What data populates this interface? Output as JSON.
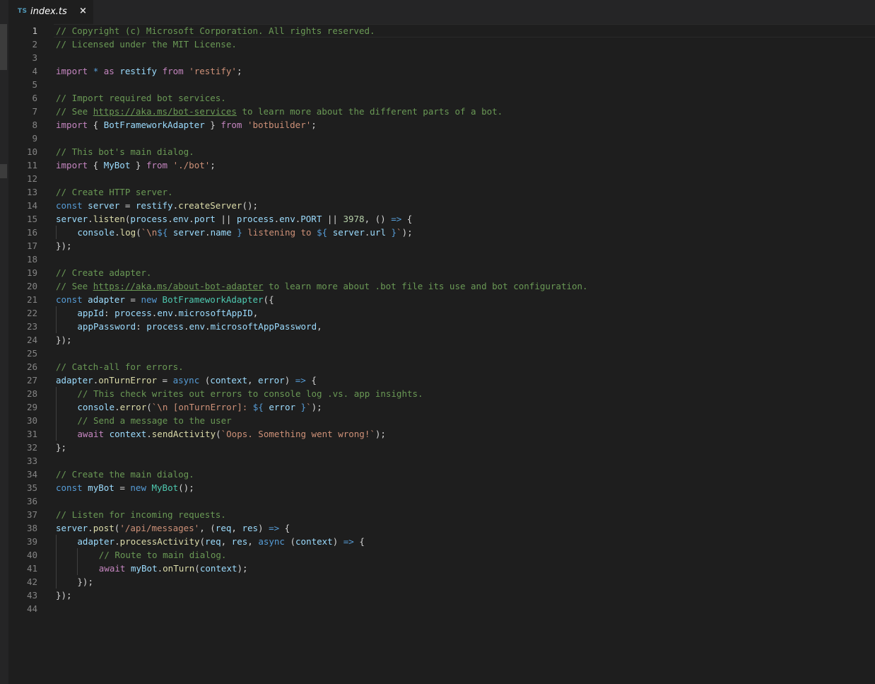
{
  "tab": {
    "language_badge": "TS",
    "filename": "index.ts",
    "close_glyph": "×"
  },
  "editor": {
    "active_line": 1,
    "lines": [
      {
        "n": 1,
        "indent": 0,
        "tokens": [
          {
            "t": "// Copyright (c) Microsoft Corporation. All rights reserved.",
            "c": "comment"
          }
        ]
      },
      {
        "n": 2,
        "indent": 0,
        "tokens": [
          {
            "t": "// Licensed under the MIT License.",
            "c": "comment"
          }
        ]
      },
      {
        "n": 3,
        "indent": 0,
        "tokens": []
      },
      {
        "n": 4,
        "indent": 0,
        "tokens": [
          {
            "t": "import",
            "c": "keyword"
          },
          {
            "t": " ",
            "c": "plain"
          },
          {
            "t": "*",
            "c": "storage"
          },
          {
            "t": " ",
            "c": "plain"
          },
          {
            "t": "as",
            "c": "keyword"
          },
          {
            "t": " ",
            "c": "plain"
          },
          {
            "t": "restify",
            "c": "var"
          },
          {
            "t": " ",
            "c": "plain"
          },
          {
            "t": "from",
            "c": "keyword"
          },
          {
            "t": " ",
            "c": "plain"
          },
          {
            "t": "'restify'",
            "c": "string"
          },
          {
            "t": ";",
            "c": "plain"
          }
        ]
      },
      {
        "n": 5,
        "indent": 0,
        "tokens": []
      },
      {
        "n": 6,
        "indent": 0,
        "tokens": [
          {
            "t": "// Import required bot services.",
            "c": "comment"
          }
        ]
      },
      {
        "n": 7,
        "indent": 0,
        "tokens": [
          {
            "t": "// See ",
            "c": "comment"
          },
          {
            "t": "https://aka.ms/bot-services",
            "c": "link"
          },
          {
            "t": " to learn more about the different parts of a bot.",
            "c": "comment"
          }
        ]
      },
      {
        "n": 8,
        "indent": 0,
        "tokens": [
          {
            "t": "import",
            "c": "keyword"
          },
          {
            "t": " { ",
            "c": "plain"
          },
          {
            "t": "BotFrameworkAdapter",
            "c": "var"
          },
          {
            "t": " } ",
            "c": "plain"
          },
          {
            "t": "from",
            "c": "keyword"
          },
          {
            "t": " ",
            "c": "plain"
          },
          {
            "t": "'botbuilder'",
            "c": "string"
          },
          {
            "t": ";",
            "c": "plain"
          }
        ]
      },
      {
        "n": 9,
        "indent": 0,
        "tokens": []
      },
      {
        "n": 10,
        "indent": 0,
        "tokens": [
          {
            "t": "// This bot's main dialog.",
            "c": "comment"
          }
        ]
      },
      {
        "n": 11,
        "indent": 0,
        "tokens": [
          {
            "t": "import",
            "c": "keyword"
          },
          {
            "t": " { ",
            "c": "plain"
          },
          {
            "t": "MyBot",
            "c": "var"
          },
          {
            "t": " } ",
            "c": "plain"
          },
          {
            "t": "from",
            "c": "keyword"
          },
          {
            "t": " ",
            "c": "plain"
          },
          {
            "t": "'./bot'",
            "c": "string"
          },
          {
            "t": ";",
            "c": "plain"
          }
        ]
      },
      {
        "n": 12,
        "indent": 0,
        "tokens": []
      },
      {
        "n": 13,
        "indent": 0,
        "tokens": [
          {
            "t": "// Create HTTP server.",
            "c": "comment"
          }
        ]
      },
      {
        "n": 14,
        "indent": 0,
        "tokens": [
          {
            "t": "const",
            "c": "storage"
          },
          {
            "t": " ",
            "c": "plain"
          },
          {
            "t": "server",
            "c": "var"
          },
          {
            "t": " = ",
            "c": "plain"
          },
          {
            "t": "restify",
            "c": "var"
          },
          {
            "t": ".",
            "c": "plain"
          },
          {
            "t": "createServer",
            "c": "func"
          },
          {
            "t": "();",
            "c": "plain"
          }
        ]
      },
      {
        "n": 15,
        "indent": 0,
        "tokens": [
          {
            "t": "server",
            "c": "var"
          },
          {
            "t": ".",
            "c": "plain"
          },
          {
            "t": "listen",
            "c": "func"
          },
          {
            "t": "(",
            "c": "plain"
          },
          {
            "t": "process",
            "c": "var"
          },
          {
            "t": ".",
            "c": "plain"
          },
          {
            "t": "env",
            "c": "var"
          },
          {
            "t": ".",
            "c": "plain"
          },
          {
            "t": "port",
            "c": "var"
          },
          {
            "t": " || ",
            "c": "plain"
          },
          {
            "t": "process",
            "c": "var"
          },
          {
            "t": ".",
            "c": "plain"
          },
          {
            "t": "env",
            "c": "var"
          },
          {
            "t": ".",
            "c": "plain"
          },
          {
            "t": "PORT",
            "c": "var"
          },
          {
            "t": " || ",
            "c": "plain"
          },
          {
            "t": "3978",
            "c": "number"
          },
          {
            "t": ", () ",
            "c": "plain"
          },
          {
            "t": "=>",
            "c": "storage"
          },
          {
            "t": " {",
            "c": "plain"
          }
        ]
      },
      {
        "n": 16,
        "indent": 1,
        "tokens": [
          {
            "t": "console",
            "c": "var"
          },
          {
            "t": ".",
            "c": "plain"
          },
          {
            "t": "log",
            "c": "func"
          },
          {
            "t": "(",
            "c": "plain"
          },
          {
            "t": "`\\n",
            "c": "string"
          },
          {
            "t": "${",
            "c": "storage"
          },
          {
            "t": " ",
            "c": "plain"
          },
          {
            "t": "server",
            "c": "var"
          },
          {
            "t": ".",
            "c": "plain"
          },
          {
            "t": "name",
            "c": "var"
          },
          {
            "t": " ",
            "c": "plain"
          },
          {
            "t": "}",
            "c": "storage"
          },
          {
            "t": " listening to ",
            "c": "string"
          },
          {
            "t": "${",
            "c": "storage"
          },
          {
            "t": " ",
            "c": "plain"
          },
          {
            "t": "server",
            "c": "var"
          },
          {
            "t": ".",
            "c": "plain"
          },
          {
            "t": "url",
            "c": "var"
          },
          {
            "t": " ",
            "c": "plain"
          },
          {
            "t": "}",
            "c": "storage"
          },
          {
            "t": "`",
            "c": "string"
          },
          {
            "t": ");",
            "c": "plain"
          }
        ]
      },
      {
        "n": 17,
        "indent": 0,
        "tokens": [
          {
            "t": "});",
            "c": "plain"
          }
        ]
      },
      {
        "n": 18,
        "indent": 0,
        "tokens": []
      },
      {
        "n": 19,
        "indent": 0,
        "tokens": [
          {
            "t": "// Create adapter.",
            "c": "comment"
          }
        ]
      },
      {
        "n": 20,
        "indent": 0,
        "tokens": [
          {
            "t": "// See ",
            "c": "comment"
          },
          {
            "t": "https://aka.ms/about-bot-adapter",
            "c": "link"
          },
          {
            "t": " to learn more about .bot file its use and bot configuration.",
            "c": "comment"
          }
        ]
      },
      {
        "n": 21,
        "indent": 0,
        "tokens": [
          {
            "t": "const",
            "c": "storage"
          },
          {
            "t": " ",
            "c": "plain"
          },
          {
            "t": "adapter",
            "c": "var"
          },
          {
            "t": " = ",
            "c": "plain"
          },
          {
            "t": "new",
            "c": "storage"
          },
          {
            "t": " ",
            "c": "plain"
          },
          {
            "t": "BotFrameworkAdapter",
            "c": "type"
          },
          {
            "t": "({",
            "c": "plain"
          }
        ]
      },
      {
        "n": 22,
        "indent": 1,
        "tokens": [
          {
            "t": "appId",
            "c": "var"
          },
          {
            "t": ": ",
            "c": "plain"
          },
          {
            "t": "process",
            "c": "var"
          },
          {
            "t": ".",
            "c": "plain"
          },
          {
            "t": "env",
            "c": "var"
          },
          {
            "t": ".",
            "c": "plain"
          },
          {
            "t": "microsoftAppID",
            "c": "var"
          },
          {
            "t": ",",
            "c": "plain"
          }
        ]
      },
      {
        "n": 23,
        "indent": 1,
        "tokens": [
          {
            "t": "appPassword",
            "c": "var"
          },
          {
            "t": ": ",
            "c": "plain"
          },
          {
            "t": "process",
            "c": "var"
          },
          {
            "t": ".",
            "c": "plain"
          },
          {
            "t": "env",
            "c": "var"
          },
          {
            "t": ".",
            "c": "plain"
          },
          {
            "t": "microsoftAppPassword",
            "c": "var"
          },
          {
            "t": ",",
            "c": "plain"
          }
        ]
      },
      {
        "n": 24,
        "indent": 0,
        "tokens": [
          {
            "t": "});",
            "c": "plain"
          }
        ]
      },
      {
        "n": 25,
        "indent": 0,
        "tokens": []
      },
      {
        "n": 26,
        "indent": 0,
        "tokens": [
          {
            "t": "// Catch-all for errors.",
            "c": "comment"
          }
        ]
      },
      {
        "n": 27,
        "indent": 0,
        "tokens": [
          {
            "t": "adapter",
            "c": "var"
          },
          {
            "t": ".",
            "c": "plain"
          },
          {
            "t": "onTurnError",
            "c": "func"
          },
          {
            "t": " = ",
            "c": "plain"
          },
          {
            "t": "async",
            "c": "storage"
          },
          {
            "t": " (",
            "c": "plain"
          },
          {
            "t": "context",
            "c": "var"
          },
          {
            "t": ", ",
            "c": "plain"
          },
          {
            "t": "error",
            "c": "var"
          },
          {
            "t": ") ",
            "c": "plain"
          },
          {
            "t": "=>",
            "c": "storage"
          },
          {
            "t": " {",
            "c": "plain"
          }
        ]
      },
      {
        "n": 28,
        "indent": 1,
        "tokens": [
          {
            "t": "// This check writes out errors to console log .vs. app insights.",
            "c": "comment"
          }
        ]
      },
      {
        "n": 29,
        "indent": 1,
        "tokens": [
          {
            "t": "console",
            "c": "var"
          },
          {
            "t": ".",
            "c": "plain"
          },
          {
            "t": "error",
            "c": "func"
          },
          {
            "t": "(",
            "c": "plain"
          },
          {
            "t": "`\\n [onTurnError]: ",
            "c": "string"
          },
          {
            "t": "${",
            "c": "storage"
          },
          {
            "t": " ",
            "c": "plain"
          },
          {
            "t": "error",
            "c": "var"
          },
          {
            "t": " ",
            "c": "plain"
          },
          {
            "t": "}",
            "c": "storage"
          },
          {
            "t": "`",
            "c": "string"
          },
          {
            "t": ");",
            "c": "plain"
          }
        ]
      },
      {
        "n": 30,
        "indent": 1,
        "tokens": [
          {
            "t": "// Send a message to the user",
            "c": "comment"
          }
        ]
      },
      {
        "n": 31,
        "indent": 1,
        "tokens": [
          {
            "t": "await",
            "c": "keyword"
          },
          {
            "t": " ",
            "c": "plain"
          },
          {
            "t": "context",
            "c": "var"
          },
          {
            "t": ".",
            "c": "plain"
          },
          {
            "t": "sendActivity",
            "c": "func"
          },
          {
            "t": "(",
            "c": "plain"
          },
          {
            "t": "`Oops. Something went wrong!`",
            "c": "string"
          },
          {
            "t": ");",
            "c": "plain"
          }
        ]
      },
      {
        "n": 32,
        "indent": 0,
        "tokens": [
          {
            "t": "};",
            "c": "plain"
          }
        ]
      },
      {
        "n": 33,
        "indent": 0,
        "tokens": []
      },
      {
        "n": 34,
        "indent": 0,
        "tokens": [
          {
            "t": "// Create the main dialog.",
            "c": "comment"
          }
        ]
      },
      {
        "n": 35,
        "indent": 0,
        "tokens": [
          {
            "t": "const",
            "c": "storage"
          },
          {
            "t": " ",
            "c": "plain"
          },
          {
            "t": "myBot",
            "c": "var"
          },
          {
            "t": " = ",
            "c": "plain"
          },
          {
            "t": "new",
            "c": "storage"
          },
          {
            "t": " ",
            "c": "plain"
          },
          {
            "t": "MyBot",
            "c": "type"
          },
          {
            "t": "();",
            "c": "plain"
          }
        ]
      },
      {
        "n": 36,
        "indent": 0,
        "tokens": []
      },
      {
        "n": 37,
        "indent": 0,
        "tokens": [
          {
            "t": "// Listen for incoming requests.",
            "c": "comment"
          }
        ]
      },
      {
        "n": 38,
        "indent": 0,
        "tokens": [
          {
            "t": "server",
            "c": "var"
          },
          {
            "t": ".",
            "c": "plain"
          },
          {
            "t": "post",
            "c": "func"
          },
          {
            "t": "(",
            "c": "plain"
          },
          {
            "t": "'/api/messages'",
            "c": "string"
          },
          {
            "t": ", (",
            "c": "plain"
          },
          {
            "t": "req",
            "c": "var"
          },
          {
            "t": ", ",
            "c": "plain"
          },
          {
            "t": "res",
            "c": "var"
          },
          {
            "t": ") ",
            "c": "plain"
          },
          {
            "t": "=>",
            "c": "storage"
          },
          {
            "t": " {",
            "c": "plain"
          }
        ]
      },
      {
        "n": 39,
        "indent": 1,
        "tokens": [
          {
            "t": "adapter",
            "c": "var"
          },
          {
            "t": ".",
            "c": "plain"
          },
          {
            "t": "processActivity",
            "c": "func"
          },
          {
            "t": "(",
            "c": "plain"
          },
          {
            "t": "req",
            "c": "var"
          },
          {
            "t": ", ",
            "c": "plain"
          },
          {
            "t": "res",
            "c": "var"
          },
          {
            "t": ", ",
            "c": "plain"
          },
          {
            "t": "async",
            "c": "storage"
          },
          {
            "t": " (",
            "c": "plain"
          },
          {
            "t": "context",
            "c": "var"
          },
          {
            "t": ") ",
            "c": "plain"
          },
          {
            "t": "=>",
            "c": "storage"
          },
          {
            "t": " {",
            "c": "plain"
          }
        ]
      },
      {
        "n": 40,
        "indent": 2,
        "tokens": [
          {
            "t": "// Route to main dialog.",
            "c": "comment"
          }
        ]
      },
      {
        "n": 41,
        "indent": 2,
        "tokens": [
          {
            "t": "await",
            "c": "keyword"
          },
          {
            "t": " ",
            "c": "plain"
          },
          {
            "t": "myBot",
            "c": "var"
          },
          {
            "t": ".",
            "c": "plain"
          },
          {
            "t": "onTurn",
            "c": "func"
          },
          {
            "t": "(",
            "c": "plain"
          },
          {
            "t": "context",
            "c": "var"
          },
          {
            "t": ");",
            "c": "plain"
          }
        ]
      },
      {
        "n": 42,
        "indent": 1,
        "tokens": [
          {
            "t": "});",
            "c": "plain"
          }
        ]
      },
      {
        "n": 43,
        "indent": 0,
        "tokens": [
          {
            "t": "});",
            "c": "plain"
          }
        ]
      },
      {
        "n": 44,
        "indent": 0,
        "tokens": []
      }
    ]
  }
}
